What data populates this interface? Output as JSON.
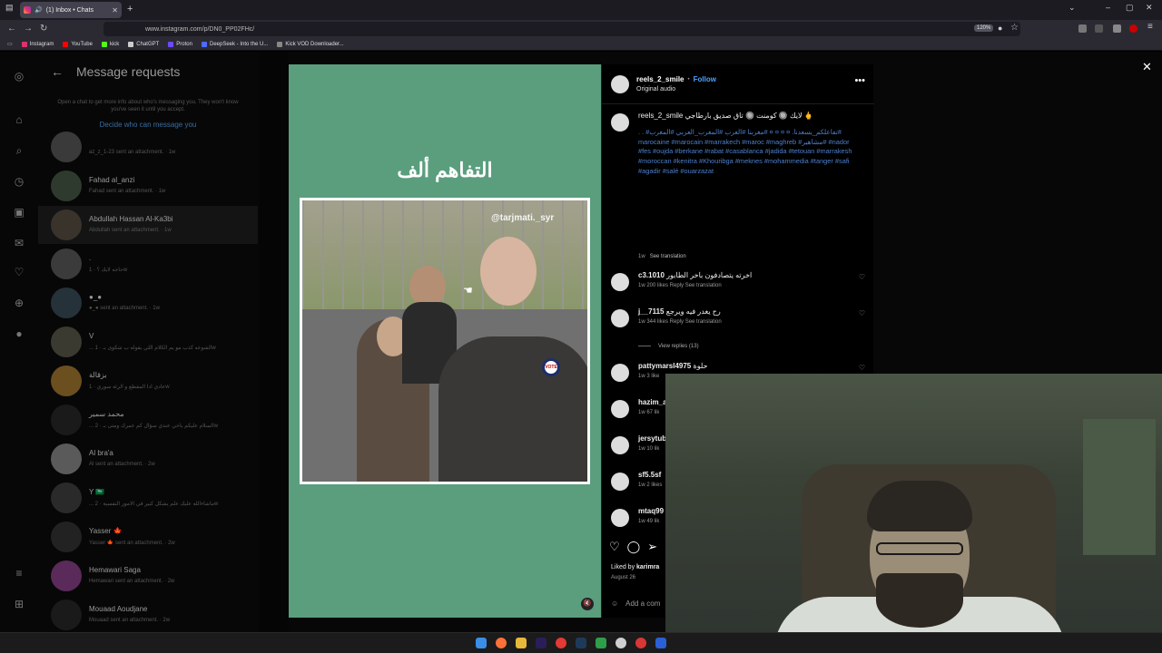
{
  "browser": {
    "tab_title": "(1) Inbox • Chats",
    "url": "www.instagram.com/p/DN0_PP02FHc/",
    "zoom": "120%",
    "bookmarks": [
      {
        "label": "Instagram",
        "color": "#e1306c"
      },
      {
        "label": "YouTube",
        "color": "#ff0000"
      },
      {
        "label": "kick",
        "color": "#53fc18"
      },
      {
        "label": "ChatGPT",
        "color": "#cccccc"
      },
      {
        "label": "Proton",
        "color": "#6d4aff"
      },
      {
        "label": "DeepSeek - Into the U...",
        "color": "#4d6bfe"
      },
      {
        "label": "Kick VOD Downloader...",
        "color": "#888888"
      }
    ]
  },
  "requests": {
    "title": "Message requests",
    "info": "Open a chat to get more info about who's messaging you. They won't know you've seen it until you accept.",
    "link": "Decide who can message you",
    "threads": [
      {
        "name": "",
        "snippet": "az_z_1-23 sent an attachment. · 1w"
      },
      {
        "name": "Fahad al_anzi",
        "snippet": "Fahad sent an attachment. · 1w"
      },
      {
        "name": "Abdullah Hassan Al-Ka3bi",
        "snippet": "Abdullah sent an attachment. · 1w"
      },
      {
        "name": ".",
        "snippet": "حاجه لايك ؟ · 1w"
      },
      {
        "name": "●_●",
        "snippet": "●_● sent an attachment. · 1w"
      },
      {
        "name": "V",
        "snippet": "... الشوعه كذب مو يم الكلام اللي يقوله ب شكوى بـ · 1w"
      },
      {
        "name": "بزقالة",
        "snippet": "عادي ادا المقطع و الرئة سوري · 1w"
      },
      {
        "name": "محمد سمير",
        "snippet": "... السلام عليكم ياخي عندي سؤال كم عمرك ومتى بـ · 2w"
      },
      {
        "name": "Al bra'a",
        "snippet": "Al sent an attachment. · 2w"
      },
      {
        "name": "Y 🇸🇦",
        "snippet": "... ماشاءالله عليك علم يشكل كبير في الامور النفسية · 2w"
      },
      {
        "name": "Yasser 🍁",
        "snippet": "Yasser 🍁 sent an attachment. · 2w"
      },
      {
        "name": "Hemawari Saga",
        "snippet": "Hemawari sent an attachment. · 2w"
      },
      {
        "name": "Mouaad Aoudjane",
        "snippet": "Mouaad sent an attachment. · 2w"
      }
    ]
  },
  "post": {
    "media_title": "التفاهم ألف",
    "watermark": "@tarjmati._syr",
    "badge": "VOTE",
    "author": "reels_2_smile",
    "follow": "Follow",
    "audio": "Original audio",
    "caption_line": "reels_2_smile لايك 🔘 كومنت 🔘 تاق صديق بارطاجي 🖕",
    "caption_body": ". . #تفاعلكم_يسعدنا. ¤ ¤ ¤ ¤ #مغربنا #العرب #المغرب_العربي #المغرب# marocaine #marocain #marrakech #maroc #maghreb #مشاهير# #nador #fes #oujda #berkane #rabat #casablanca #jadida #tetouan #marrakesh #moroccan #kenitra #Khouribga #meknes #mohammedia #tanger #safi #agadir #salé #ouarzazat",
    "caption_meta": "1w",
    "see_translation": "See translation",
    "view_replies": "View replies (13)",
    "comments": [
      {
        "user": "c3.1010",
        "text": "اخرته يتصادفون باخر الطابور",
        "meta": "1w   200 likes   Reply   See translation"
      },
      {
        "user": "j__7115",
        "text": "رح يغدر فيه ويرجع",
        "meta": "1w   344 likes   Reply   See translation"
      },
      {
        "user": "pattymarsl4975",
        "text": "حلوة",
        "meta": "1w   3 like"
      },
      {
        "user": "hazim_al",
        "text": "",
        "meta": "1w   67 lik"
      },
      {
        "user": "jersytube",
        "text": "",
        "meta": "1w   10 lik"
      },
      {
        "user": "sf5.5sf",
        "text": "",
        "meta": "1w   2 likes"
      },
      {
        "user": "mtaq99",
        "text": "",
        "meta": "1w   49 lik"
      }
    ],
    "liked_by_prefix": "Liked by",
    "liked_by_user": "karimra",
    "date": "August 26",
    "add_comment": "Add a com"
  }
}
